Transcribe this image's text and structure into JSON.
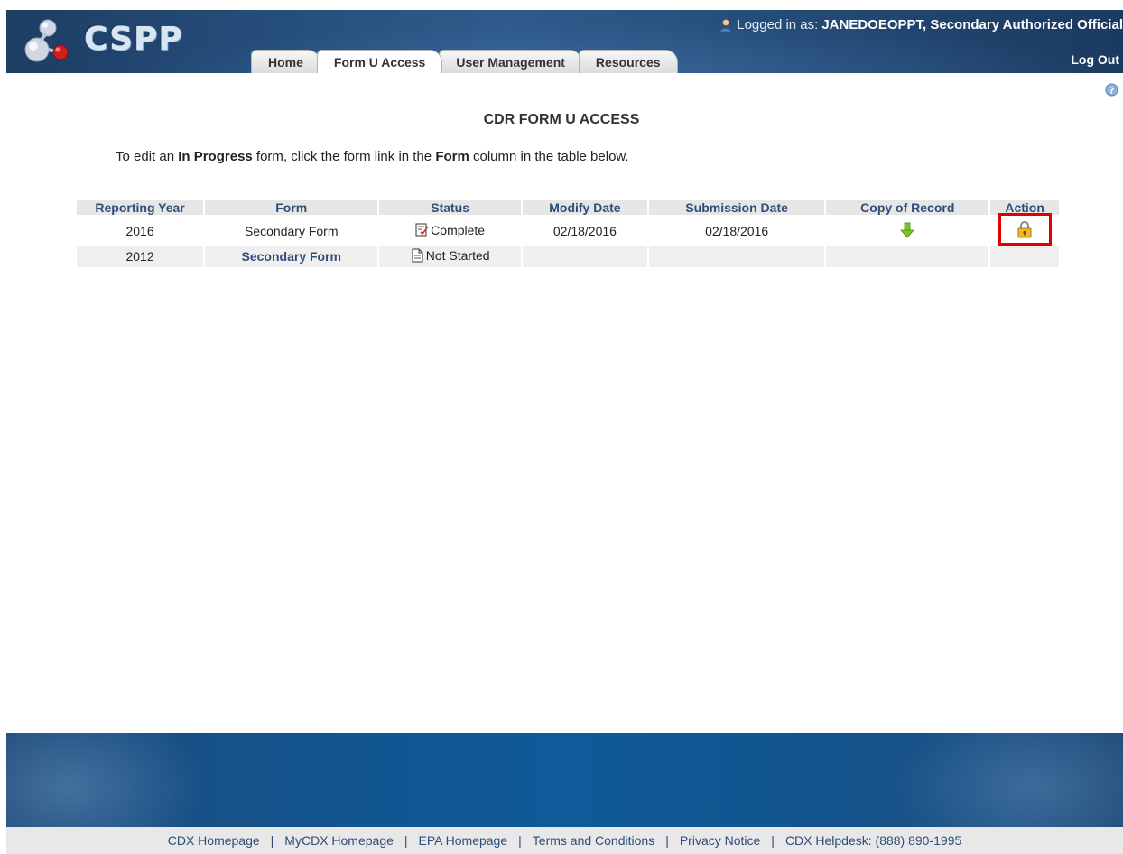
{
  "header": {
    "logo_text": "CSPP",
    "login_prefix": "Logged in as: ",
    "login_user": "JANEDOEOPPT, Secondary Authorized Official",
    "logout_label": "Log Out"
  },
  "tabs": [
    {
      "label": "Home",
      "active": false
    },
    {
      "label": "Form U Access",
      "active": true
    },
    {
      "label": "User Management",
      "active": false
    },
    {
      "label": "Resources",
      "active": false
    }
  ],
  "main": {
    "title": "CDR FORM U ACCESS",
    "instructions": {
      "part1": "To edit an ",
      "bold1": "In Progress",
      "part2": " form, click the form link in the ",
      "bold2": "Form",
      "part3": " column in the table below."
    },
    "table": {
      "headers": [
        "Reporting Year",
        "Form",
        "Status",
        "Modify Date",
        "Submission Date",
        "Copy of Record",
        "Action"
      ],
      "rows": [
        {
          "year": "2016",
          "form": "Secondary Form",
          "status": "Complete",
          "modify_date": "02/18/2016",
          "submission_date": "02/18/2016",
          "copy_icon": "download-arrow-icon",
          "action_icon": "lock-icon"
        },
        {
          "year": "2012",
          "form": "Secondary Form",
          "status": "Not Started",
          "modify_date": "",
          "submission_date": "",
          "copy_icon": "",
          "action_icon": ""
        }
      ]
    }
  },
  "footer": {
    "links": [
      "CDX Homepage",
      "MyCDX Homepage",
      "EPA Homepage",
      "Terms and Conditions",
      "Privacy Notice"
    ],
    "helpdesk": "CDX Helpdesk: (888) 890-1995"
  },
  "colors": {
    "header_blue": "#244b77",
    "link_blue": "#2e4d79",
    "highlight_red": "#e00000",
    "footer_blue": "#12558f"
  }
}
